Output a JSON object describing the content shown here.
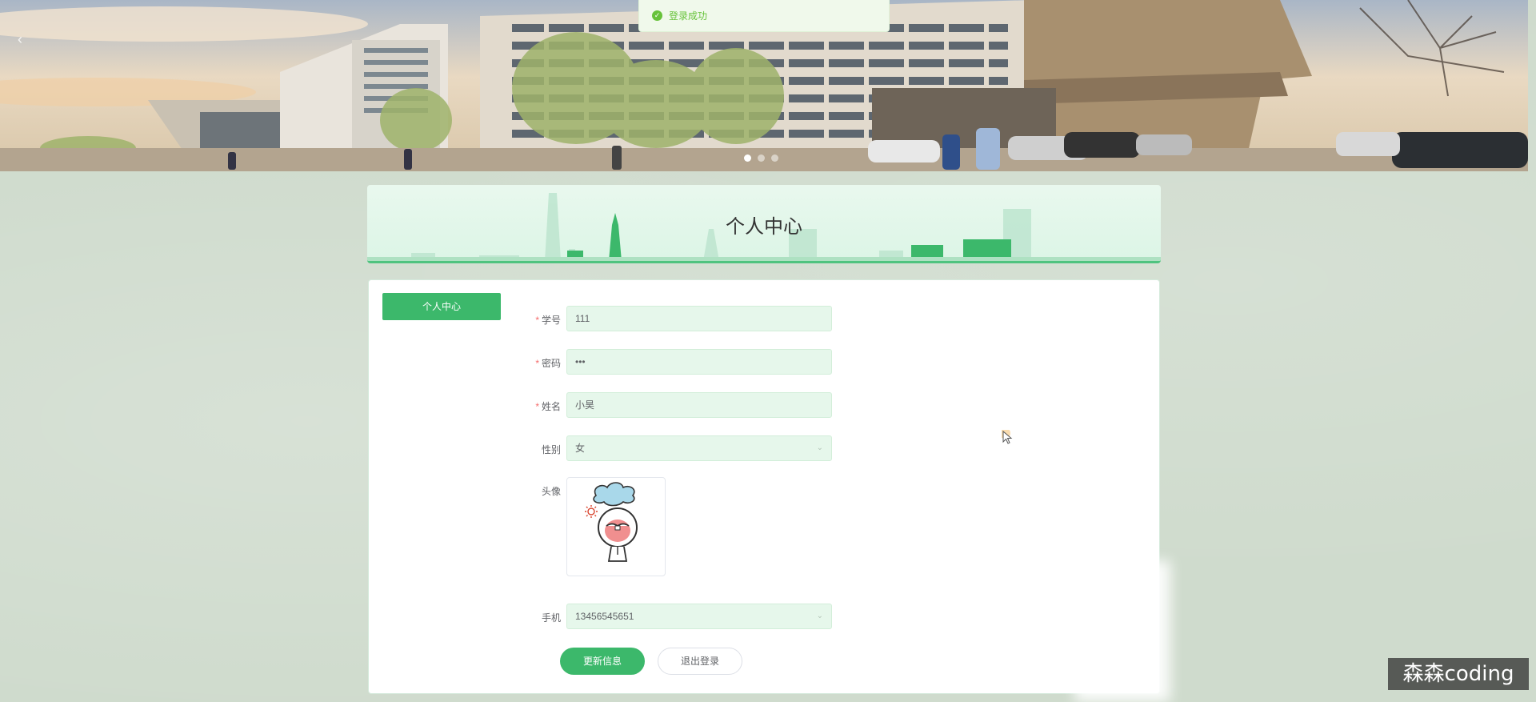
{
  "toast": {
    "icon": "check-circle-icon",
    "message": "登录成功",
    "color": "#67c23a"
  },
  "banner": {
    "slide_count": 3,
    "active_slide": 1,
    "prev_icon": "chevron-left-icon"
  },
  "header": {
    "title": "个人中心"
  },
  "sidebar": {
    "items": [
      {
        "label": "个人中心",
        "active": true
      }
    ]
  },
  "form": {
    "student_id": {
      "label": "学号",
      "required": true,
      "value": "111"
    },
    "password": {
      "label": "密码",
      "required": true,
      "value": "•••"
    },
    "name": {
      "label": "姓名",
      "required": true,
      "value": "小昊"
    },
    "gender": {
      "label": "性别",
      "required": false,
      "value": "女"
    },
    "avatar": {
      "label": "头像"
    },
    "phone": {
      "label": "手机",
      "required": false,
      "value": "13456545651"
    }
  },
  "buttons": {
    "update": "更新信息",
    "logout": "退出登录"
  },
  "colors": {
    "accent": "#3cb86b",
    "input_bg": "#e6f7eb",
    "page_bg": "#cfdbcd"
  },
  "watermark": "森森coding"
}
